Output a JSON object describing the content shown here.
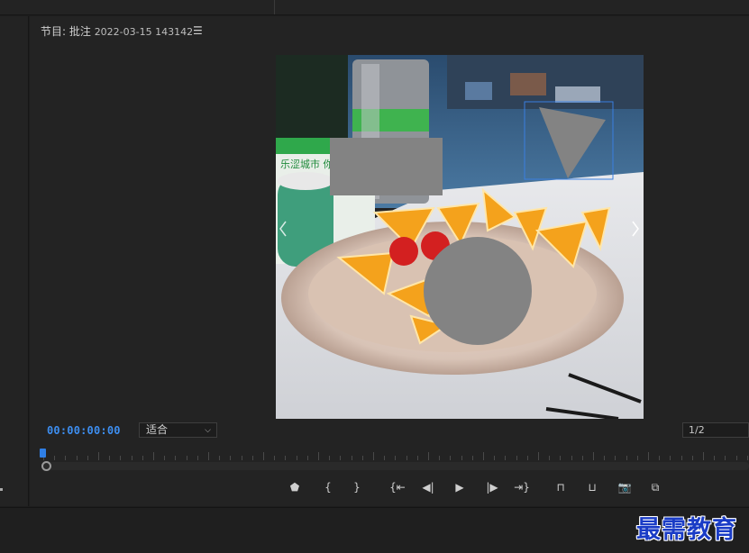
{
  "panel": {
    "title": "节目: 批注",
    "sequence_date": "2022-03-15 143142",
    "menu_icon": "hamburger-icon"
  },
  "preview": {
    "prev_icon": "chevron-left-icon",
    "next_icon": "chevron-right-icon",
    "shape_color": "#838383",
    "selection_color": "#3a7fe0"
  },
  "playback": {
    "timecode": "00:00:00:00",
    "fit_value": "适合",
    "resolution_value": "1/2"
  },
  "controls": [
    {
      "name": "add-marker-button",
      "glyph": "⬟"
    },
    {
      "name": "mark-in-button",
      "glyph": "{"
    },
    {
      "name": "mark-out-button",
      "glyph": "}"
    },
    {
      "name": "go-to-in-button",
      "glyph": "{⇤"
    },
    {
      "name": "step-back-button",
      "glyph": "◀|"
    },
    {
      "name": "play-button",
      "glyph": "▶"
    },
    {
      "name": "step-forward-button",
      "glyph": "|▶"
    },
    {
      "name": "go-to-out-button",
      "glyph": "⇥}"
    },
    {
      "name": "lift-button",
      "glyph": "⊓"
    },
    {
      "name": "extract-button",
      "glyph": "⊔"
    },
    {
      "name": "export-frame-button",
      "glyph": "📷"
    },
    {
      "name": "compare-view-button",
      "glyph": "⧉"
    }
  ],
  "accent_color": "#3d8ef0",
  "watermark": "最需教育"
}
